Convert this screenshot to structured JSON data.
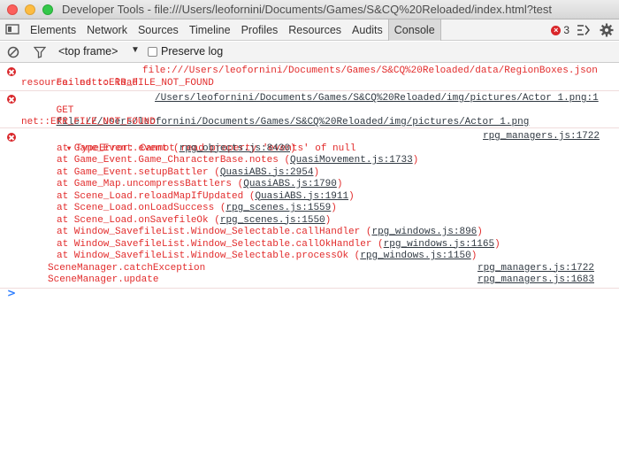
{
  "window": {
    "title": "Developer Tools - file:///Users/leofornini/Documents/Games/S&CQ%20Reloaded/index.html?test"
  },
  "tabs": [
    {
      "label": "Elements"
    },
    {
      "label": "Network"
    },
    {
      "label": "Sources"
    },
    {
      "label": "Timeline"
    },
    {
      "label": "Profiles"
    },
    {
      "label": "Resources"
    },
    {
      "label": "Audits"
    },
    {
      "label": "Console"
    }
  ],
  "status": {
    "error_count": "3"
  },
  "toolbar": {
    "frame_select": "<top frame>",
    "preserve_log_label": "Preserve log"
  },
  "messages": {
    "m1": {
      "line1": "Failed to load",
      "url": "file:///Users/leofornini/Documents/Games/S&CQ%20Reloaded/data/RegionBoxes.json",
      "line2": "resource: net::ERR_FILE_NOT_FOUND"
    },
    "m2": {
      "method": "GET",
      "path": "/Users/leofornini/Documents/Games/S&CQ%20Reloaded/img/pictures/Actor 1.png:1",
      "url": "file:///Users/leofornini/Documents/Games/S&CQ%20Reloaded/img/pictures/Actor 1.png",
      "error": "net::ERR_FILE_NOT_FOUND"
    },
    "m3": {
      "summary": "TypeError: Cannot read property 'events' of null",
      "source": "rpg_managers.js:1722",
      "stack": [
        {
          "text": "at Game_Event.event (",
          "link": "rpg_objects.js:8430",
          "end": ")"
        },
        {
          "text": "at Game_Event.Game_CharacterBase.notes (",
          "link": "QuasiMovement.js:1733",
          "end": ")"
        },
        {
          "text": "at Game_Event.setupBattler (",
          "link": "QuasiABS.js:2954",
          "end": ")"
        },
        {
          "text": "at Game_Map.uncompressBattlers (",
          "link": "QuasiABS.js:1790",
          "end": ")"
        },
        {
          "text": "at Scene_Load.reloadMapIfUpdated (",
          "link": "QuasiABS.js:1911",
          "end": ")"
        },
        {
          "text": "at Scene_Load.onLoadSuccess (",
          "link": "rpg_scenes.js:1559",
          "end": ")"
        },
        {
          "text": "at Scene_Load.onSavefileOk (",
          "link": "rpg_scenes.js:1550",
          "end": ")"
        },
        {
          "text": "at Window_SavefileList.Window_Selectable.callHandler (",
          "link": "rpg_windows.js:896",
          "end": ")"
        },
        {
          "text": "at Window_SavefileList.Window_Selectable.callOkHandler (",
          "link": "rpg_windows.js:1165",
          "end": ")"
        },
        {
          "text": "at Window_SavefileList.Window_Selectable.processOk (",
          "link": "rpg_windows.js:1150",
          "end": ")"
        }
      ],
      "frames": [
        {
          "name": "SceneManager.catchException",
          "source": "rpg_managers.js:1722"
        },
        {
          "name": "SceneManager.update",
          "source": "rpg_managers.js:1683"
        }
      ]
    }
  },
  "prompt": ">"
}
